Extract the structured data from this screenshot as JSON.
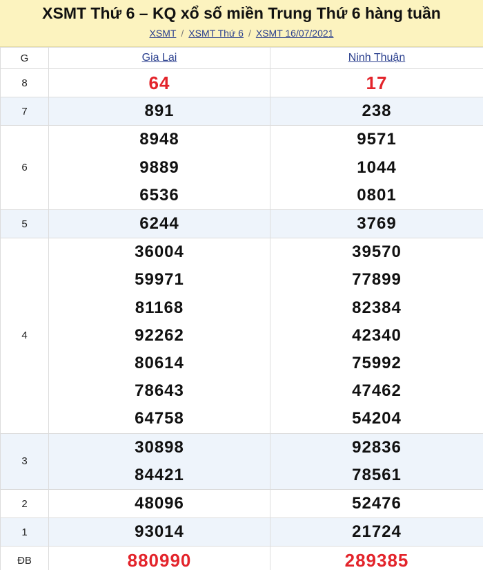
{
  "header": {
    "title": "XSMT Thứ 6 – KQ xổ số miền Trung Thứ 6 hàng tuần",
    "breadcrumb": [
      "XSMT",
      "XSMT Thứ 6",
      "XSMT 16/07/2021"
    ]
  },
  "table": {
    "col_label": "G",
    "provinces": [
      "Gia Lai",
      "Ninh Thuận"
    ],
    "prizes": [
      {
        "label": "8",
        "gia_lai": [
          "64"
        ],
        "ninh_thuan": [
          "17"
        ]
      },
      {
        "label": "7",
        "gia_lai": [
          "891"
        ],
        "ninh_thuan": [
          "238"
        ]
      },
      {
        "label": "6",
        "gia_lai": [
          "8948",
          "9889",
          "6536"
        ],
        "ninh_thuan": [
          "9571",
          "1044",
          "0801"
        ]
      },
      {
        "label": "5",
        "gia_lai": [
          "6244"
        ],
        "ninh_thuan": [
          "3769"
        ]
      },
      {
        "label": "4",
        "gia_lai": [
          "36004",
          "59971",
          "81168",
          "92262",
          "80614",
          "78643",
          "64758"
        ],
        "ninh_thuan": [
          "39570",
          "77899",
          "82384",
          "42340",
          "75992",
          "47462",
          "54204"
        ]
      },
      {
        "label": "3",
        "gia_lai": [
          "30898",
          "84421"
        ],
        "ninh_thuan": [
          "92836",
          "78561"
        ]
      },
      {
        "label": "2",
        "gia_lai": [
          "48096"
        ],
        "ninh_thuan": [
          "52476"
        ]
      },
      {
        "label": "1",
        "gia_lai": [
          "93014"
        ],
        "ninh_thuan": [
          "21724"
        ]
      },
      {
        "label": "ĐB",
        "gia_lai": [
          "880990"
        ],
        "ninh_thuan": [
          "289385"
        ]
      }
    ]
  },
  "colors": {
    "header_bg": "#fcf3bf",
    "alt_row_bg": "#eef4fb",
    "highlight_red": "#e3242b",
    "link_blue": "#2a3f8e"
  }
}
